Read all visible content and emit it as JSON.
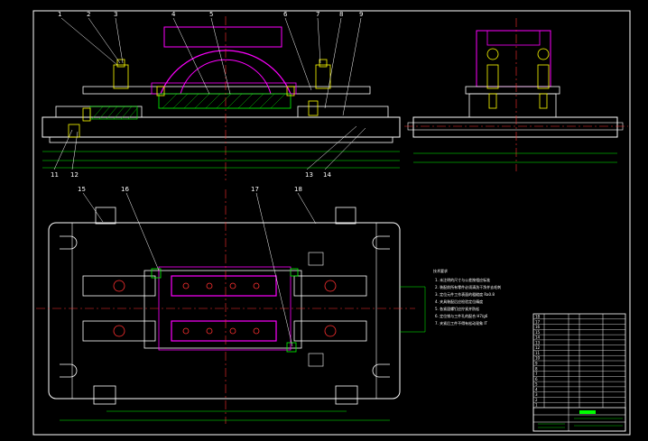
{
  "drawing": {
    "colors": {
      "background": "#000000",
      "outline": "#ffffff",
      "dimension": "#00ff00",
      "centerline": "#ff3030",
      "fixture": "#ff00ff",
      "fastener": "#ffff00",
      "hatch": "#00ff00"
    },
    "front_view": {
      "balloons": [
        "1",
        "2",
        "3",
        "4",
        "5",
        "6",
        "7",
        "8",
        "9"
      ],
      "lower_balloons": [
        "11",
        "12",
        "13",
        "14"
      ]
    },
    "plan_view": {
      "balloons": [
        "15",
        "16",
        "17",
        "18"
      ]
    },
    "notes": {
      "title": "技术要求",
      "lines": [
        "1. 未注明的尺寸与公差按相应标准",
        "2. 装配前所有零件必须清洗干净并去毛刺",
        "3. 定位元件工作表面的粗糙度 Ra0.8",
        "4. 夹具装配后应检验定位精度",
        "5. 各紧固螺钉应拧紧并防松",
        "6. 定位销与工件孔的配合 H7/g6",
        "7. 夹紧后工件不得有松动现象 IT"
      ]
    },
    "bom": {
      "rows": [
        [
          "18",
          "",
          "",
          ""
        ],
        [
          "17",
          "",
          "",
          ""
        ],
        [
          "16",
          "",
          "",
          ""
        ],
        [
          "15",
          "",
          "",
          ""
        ],
        [
          "14",
          "",
          "",
          ""
        ],
        [
          "13",
          "",
          "",
          ""
        ],
        [
          "12",
          "",
          "",
          ""
        ],
        [
          "11",
          "",
          "",
          ""
        ],
        [
          "10",
          "",
          "",
          ""
        ],
        [
          "9",
          "",
          "",
          ""
        ],
        [
          "8",
          "",
          "",
          ""
        ],
        [
          "7",
          "",
          "",
          ""
        ],
        [
          "6",
          "",
          "",
          ""
        ],
        [
          "5",
          "",
          "",
          ""
        ],
        [
          "4",
          "",
          "",
          ""
        ],
        [
          "3",
          "",
          "",
          ""
        ],
        [
          "2",
          "",
          "",
          ""
        ],
        [
          "1",
          "",
          "",
          ""
        ]
      ]
    }
  }
}
